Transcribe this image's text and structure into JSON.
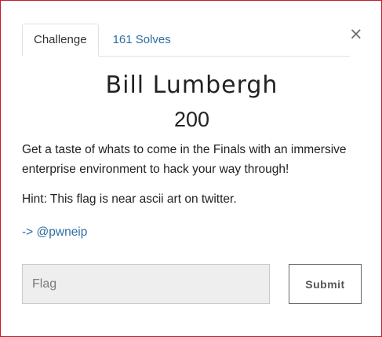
{
  "tabs": [
    {
      "label": "Challenge",
      "active": true
    },
    {
      "label": "161 Solves",
      "active": false
    }
  ],
  "close_glyph": "×",
  "challenge": {
    "name": "Bill Lumbergh",
    "value": "200",
    "description": "Get a taste of whats to come in the Finals with an immersive enterprise environment to hack your way through!",
    "hint": "Hint: This flag is near ascii art on twitter.",
    "link_text": "-> @pwneip"
  },
  "form": {
    "flag_placeholder": "Flag",
    "flag_value": "",
    "submit_label": "Submit"
  },
  "colors": {
    "border": "#c0202a",
    "link": "#2e6da4",
    "input_bg": "#eeeeee"
  }
}
